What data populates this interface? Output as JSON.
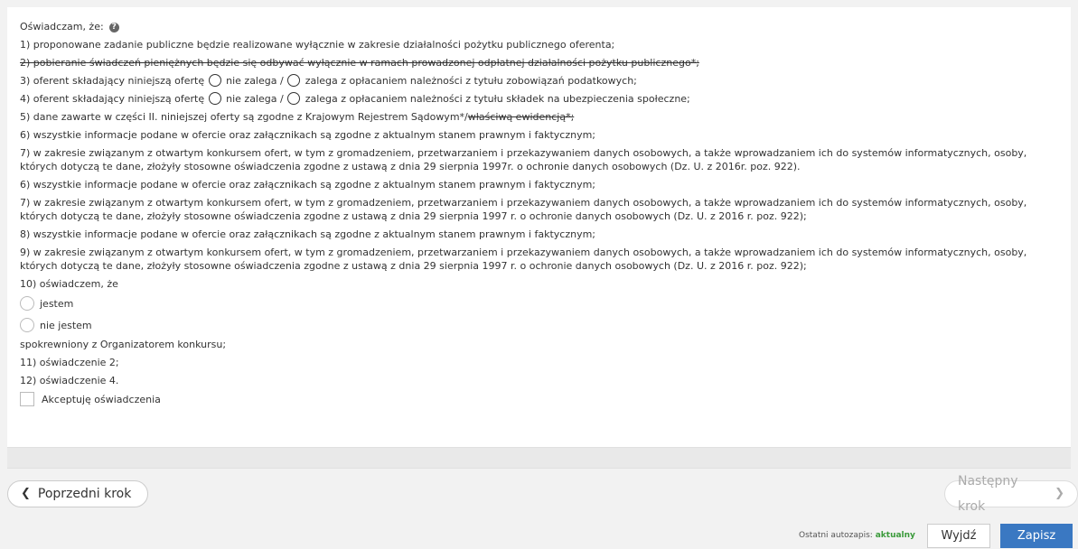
{
  "header": {
    "title": "Oświadczam, że:"
  },
  "statements": {
    "s1": "1) proponowane zadanie publiczne będzie realizowane wyłącznie w zakresie działalności pożytku publicznego oferenta;",
    "s2": "2) pobieranie świadczeń pieniężnych będzie się odbywać wyłącznie w ramach prowadzonej odpłatnej działalności pożytku publicznego*;",
    "s3_pre": "3) oferent składający niniejszą ofertę",
    "s3_opt1": "nie zalega /",
    "s3_opt2": "zalega z opłacaniem należności z tytułu zobowiązań podatkowych;",
    "s4_pre": "4) oferent składający niniejszą ofertę",
    "s4_opt1": "nie zalega /",
    "s4_opt2": "zalega z opłacaniem należności z tytułu składek na ubezpieczenia społeczne;",
    "s5_main": "5) dane zawarte w części II. niniejszej oferty są zgodne z Krajowym Rejestrem Sądowym*/",
    "s5_strike": "właściwą ewidencją*;",
    "s6a": "6) wszystkie informacje podane w ofercie oraz załącznikach są zgodne z aktualnym stanem prawnym i faktycznym;",
    "s7a": "7) w zakresie związanym z otwartym konkursem ofert, w tym z gromadzeniem, przetwarzaniem i przekazywaniem danych osobowych, a także wprowadzaniem ich do systemów informatycznych, osoby, których dotyczą te dane, złożyły stosowne oświadczenia zgodne z ustawą z dnia 29 sierpnia 1997r. o ochronie danych osobowych (Dz. U. z 2016r. poz. 922).",
    "s6b": "6) wszystkie informacje podane w ofercie oraz załącznikach są zgodne z aktualnym stanem prawnym i faktycznym;",
    "s7b": "7) w zakresie związanym z otwartym konkursem ofert, w tym z gromadzeniem, przetwarzaniem i przekazywaniem danych osobowych, a także wprowadzaniem ich do systemów informatycznych, osoby, których dotyczą te dane, złożyły stosowne oświadczenia zgodne z ustawą z dnia 29 sierpnia 1997 r. o ochronie danych osobowych (Dz. U. z 2016 r. poz. 922);",
    "s8": "8) wszystkie informacje podane w ofercie oraz załącznikach są zgodne z aktualnym stanem prawnym i faktycznym;",
    "s9": "9) w zakresie związanym z otwartym konkursem ofert, w tym z gromadzeniem, przetwarzaniem i przekazywaniem danych osobowych, a także wprowadzaniem ich do systemów informatycznych, osoby, których dotyczą te dane, złożyły stosowne oświadczenia zgodne z ustawą z dnia 29 sierpnia 1997 r. o ochronie danych osobowych (Dz. U. z 2016 r. poz. 922);",
    "s10": "10) oświadczem, że",
    "s10_opt1": "jestem",
    "s10_opt2": "nie jestem",
    "s10_tail": "spokrewniony z Organizatorem konkursu;",
    "s11": "11) oświadczenie 2;",
    "s12": "12) oświadczenie 4."
  },
  "accept": {
    "label": "Akceptuję oświadczenia"
  },
  "nav": {
    "prev": "Poprzedni krok",
    "next": "Następny krok"
  },
  "footer": {
    "autosave_label": "Ostatni autozapis:",
    "autosave_status": "aktualny",
    "exit": "Wyjdź",
    "save": "Zapisz"
  },
  "colors": {
    "primary": "#3a78c2",
    "ok": "#3a9a3a"
  }
}
